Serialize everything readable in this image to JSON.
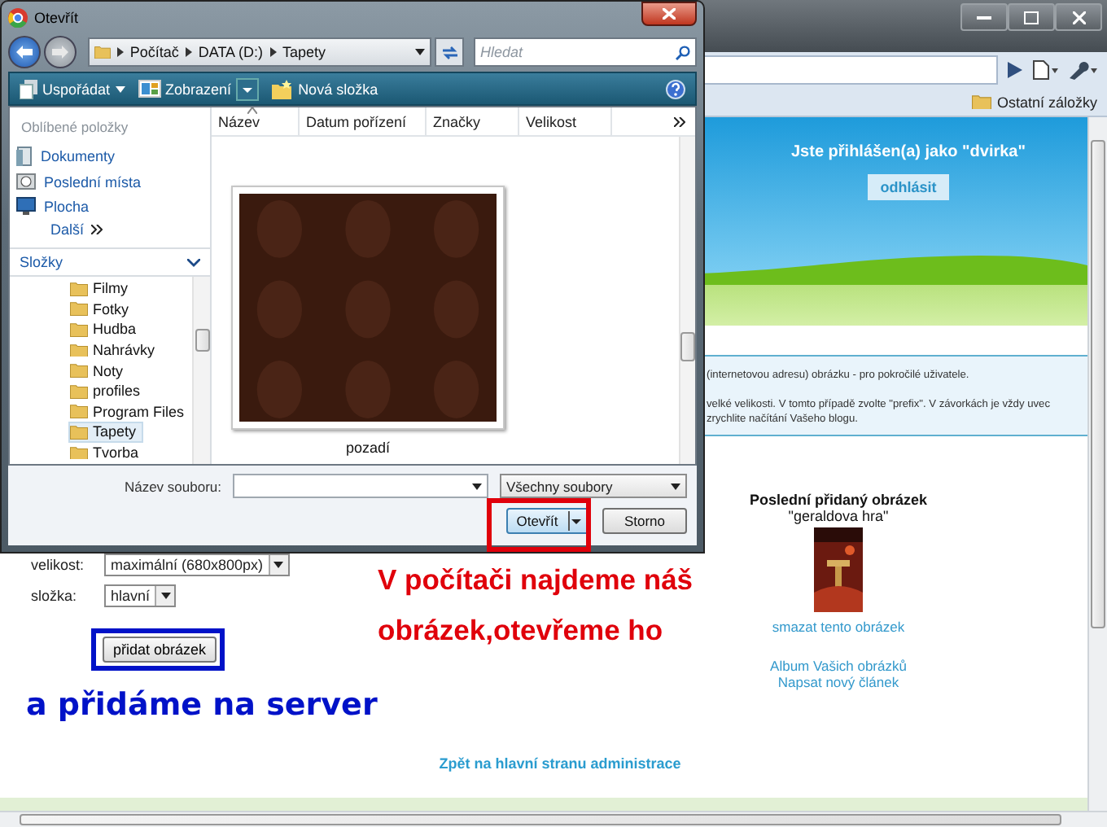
{
  "browser": {
    "bookmarks": [
      {
        "label": "Ostatní záložky"
      }
    ],
    "page": {
      "login_text": "Jste přihlášen(a) jako \"dvirka\"",
      "logout_button": "odhlásit",
      "info_lines": [
        "(internetovou adresu) obrázku - pro pokročilé uživatele.",
        "velké velikosti. V tomto případě zvolte \"prefix\". V závorkách je vždy uvec",
        "zrychlite načítání Vašeho blogu."
      ],
      "form": [
        {
          "label": "velikost:",
          "value": "maximální (680x800px)"
        },
        {
          "label": "složka:",
          "value": "hlavní"
        }
      ],
      "submit_button": "přidat obrázek",
      "latest": {
        "title": "Poslední přidaný obrázek",
        "name": "\"geraldova hra\"",
        "delete_link": "smazat tento obrázek"
      },
      "links": [
        "Album Vašich obrázků",
        "Napsat nový článek"
      ],
      "back_link": "Zpět na hlavní stranu administrace"
    }
  },
  "dialog": {
    "title": "Otevřít",
    "breadcrumb": [
      "Počítač",
      "DATA (D:)",
      "Tapety"
    ],
    "search": {
      "placeholder": "Hledat"
    },
    "toolbar": [
      {
        "label": "Uspořádat",
        "kind": "menu"
      },
      {
        "label": "Zobrazení",
        "kind": "split"
      },
      {
        "label": "Nová složka",
        "kind": "folder"
      }
    ],
    "favorites_header": "Oblíbené položky",
    "favorites": [
      {
        "label": "Dokumenty",
        "kind": "docs"
      },
      {
        "label": "Poslední místa",
        "kind": "recent"
      },
      {
        "label": "Plocha",
        "kind": "desktop"
      }
    ],
    "more": "Další",
    "folders_header": "Složky",
    "folders": [
      {
        "label": "Filmy",
        "selected": false
      },
      {
        "label": "Fotky",
        "selected": false
      },
      {
        "label": "Hudba",
        "selected": false
      },
      {
        "label": "Nahrávky",
        "selected": false
      },
      {
        "label": "Noty",
        "selected": false
      },
      {
        "label": "profiles",
        "selected": false
      },
      {
        "label": "Program Files",
        "selected": false
      },
      {
        "label": "Tapety",
        "selected": true
      },
      {
        "label": "Tvorba",
        "selected": false
      }
    ],
    "columns": [
      {
        "label": "Název",
        "sorted": true
      },
      {
        "label": "Datum pořízení",
        "sorted": false
      },
      {
        "label": "Značky",
        "sorted": false
      },
      {
        "label": "Velikost",
        "sorted": false
      }
    ],
    "files": [
      {
        "name": "pozadí",
        "kind": "picture"
      }
    ],
    "filename_label": "Název souboru:",
    "filter": "Všechny soubory",
    "buttons": [
      {
        "label": "Otevřít",
        "kind": "split"
      },
      {
        "label": "Storno",
        "kind": "plain"
      }
    ]
  },
  "annotations": {
    "red_lines": [
      "V počítači najdeme náš",
      "obrázek,otevřeme ho"
    ],
    "blue_text": "a přidáme na server"
  }
}
